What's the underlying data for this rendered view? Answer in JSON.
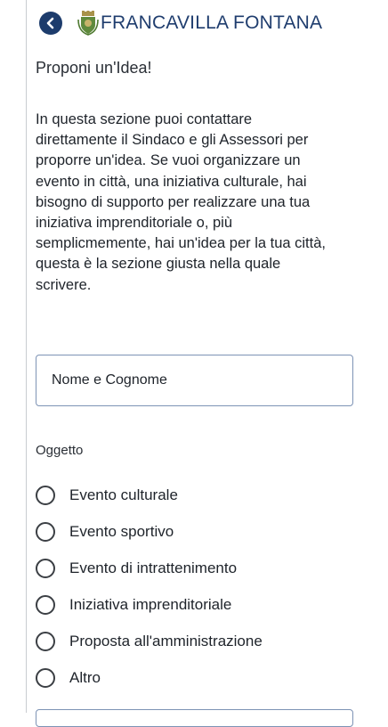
{
  "header": {
    "title": "FRANCAVILLA FONTANA",
    "back_icon": "chevron-left-icon",
    "crest_icon": "city-crest-icon",
    "accent_color": "#1d3c6c"
  },
  "section": {
    "heading": "Proponi un'Idea!",
    "intro_lines": [
      "In questa sezione puoi contattare",
      "direttamente il Sindaco e gli Assessori per",
      "proporre un'idea. Se vuoi organizzare un",
      "evento in città, una iniziativa culturale, hai",
      "bisogno di supporto per realizzare una tua",
      "iniziativa imprenditoriale o, più",
      "semplicmemente, hai un'idea per la tua città,",
      "questa è la sezione giusta nella quale",
      "scrivere."
    ]
  },
  "form": {
    "name_placeholder": "Nome e Cognome",
    "subject_label": "Oggetto",
    "subject_options": [
      "Evento culturale",
      "Evento sportivo",
      "Evento di intrattenimento",
      "Iniziativa imprenditoriale",
      "Proposta all'amministrazione",
      "Altro"
    ]
  }
}
